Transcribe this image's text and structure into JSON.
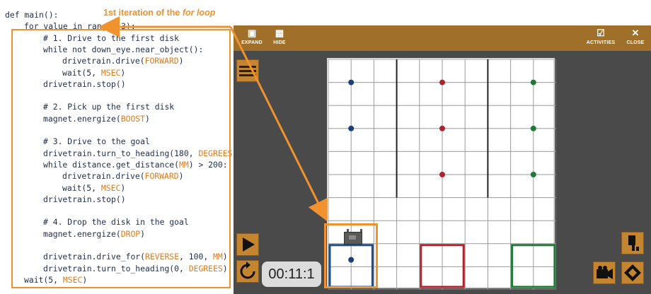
{
  "annotation": {
    "label_pre": "1st iteration of the ",
    "label_em": "for loop"
  },
  "code": [
    {
      "i": 0,
      "parts": [
        {
          "t": "def main():",
          "c": "kw"
        }
      ]
    },
    {
      "i": 1,
      "parts": [
        {
          "t": "for value in range (3):",
          "c": "kw"
        }
      ]
    },
    {
      "i": 2,
      "parts": [
        {
          "t": "# 1. Drive to the first disk",
          "c": "kw"
        }
      ]
    },
    {
      "i": 2,
      "parts": [
        {
          "t": "while not down_eye.near_object():",
          "c": "kw"
        }
      ]
    },
    {
      "i": 3,
      "parts": [
        {
          "t": "drivetrain.drive(",
          "c": "kw"
        },
        {
          "t": "FORWARD",
          "c": "cst"
        },
        {
          "t": ")",
          "c": "kw"
        }
      ]
    },
    {
      "i": 3,
      "parts": [
        {
          "t": "wait(5, ",
          "c": "kw"
        },
        {
          "t": "MSEC",
          "c": "cst"
        },
        {
          "t": ")",
          "c": "kw"
        }
      ]
    },
    {
      "i": 2,
      "parts": [
        {
          "t": "drivetrain.stop()",
          "c": "kw"
        }
      ]
    },
    {
      "i": 2,
      "parts": [
        {
          "t": "",
          "c": "kw"
        }
      ]
    },
    {
      "i": 2,
      "parts": [
        {
          "t": "# 2. Pick up the first disk",
          "c": "kw"
        }
      ]
    },
    {
      "i": 2,
      "parts": [
        {
          "t": "magnet.energize(",
          "c": "kw"
        },
        {
          "t": "BOOST",
          "c": "cst"
        },
        {
          "t": ")",
          "c": "kw"
        }
      ]
    },
    {
      "i": 2,
      "parts": [
        {
          "t": "",
          "c": "kw"
        }
      ]
    },
    {
      "i": 2,
      "parts": [
        {
          "t": "# 3. Drive to the goal",
          "c": "kw"
        }
      ]
    },
    {
      "i": 2,
      "parts": [
        {
          "t": "drivetrain.turn_to_heading(180, ",
          "c": "kw"
        },
        {
          "t": "DEGREES",
          "c": "cst"
        },
        {
          "t": ")",
          "c": "kw"
        }
      ]
    },
    {
      "i": 2,
      "parts": [
        {
          "t": "while distance.get_distance(",
          "c": "kw"
        },
        {
          "t": "MM",
          "c": "cst"
        },
        {
          "t": ") > 200:",
          "c": "kw"
        }
      ]
    },
    {
      "i": 3,
      "parts": [
        {
          "t": "drivetrain.drive(",
          "c": "kw"
        },
        {
          "t": "FORWARD",
          "c": "cst"
        },
        {
          "t": ")",
          "c": "kw"
        }
      ]
    },
    {
      "i": 3,
      "parts": [
        {
          "t": "wait(5, ",
          "c": "kw"
        },
        {
          "t": "MSEC",
          "c": "cst"
        },
        {
          "t": ")",
          "c": "kw"
        }
      ]
    },
    {
      "i": 2,
      "parts": [
        {
          "t": "drivetrain.stop()",
          "c": "kw"
        }
      ]
    },
    {
      "i": 2,
      "parts": [
        {
          "t": "",
          "c": "kw"
        }
      ]
    },
    {
      "i": 2,
      "parts": [
        {
          "t": "# 4. Drop the disk in the goal",
          "c": "kw"
        }
      ]
    },
    {
      "i": 2,
      "parts": [
        {
          "t": "magnet.energize(",
          "c": "kw"
        },
        {
          "t": "DROP",
          "c": "cst"
        },
        {
          "t": ")",
          "c": "kw"
        }
      ]
    },
    {
      "i": 2,
      "parts": [
        {
          "t": "",
          "c": "kw"
        }
      ]
    },
    {
      "i": 2,
      "parts": [
        {
          "t": "drivetrain.drive_for(",
          "c": "kw"
        },
        {
          "t": "REVERSE",
          "c": "cst"
        },
        {
          "t": ", 100, ",
          "c": "kw"
        },
        {
          "t": "MM",
          "c": "cst"
        },
        {
          "t": ")",
          "c": "kw"
        }
      ]
    },
    {
      "i": 2,
      "parts": [
        {
          "t": "drivetrain.turn_to_heading(0, ",
          "c": "kw"
        },
        {
          "t": "DEGREES",
          "c": "cst"
        },
        {
          "t": ")",
          "c": "kw"
        }
      ]
    },
    {
      "i": 1,
      "parts": [
        {
          "t": "wait(5, ",
          "c": "kw"
        },
        {
          "t": "MSEC",
          "c": "cst"
        },
        {
          "t": ")",
          "c": "kw"
        }
      ]
    }
  ],
  "toolbar": {
    "expand": "EXPAND",
    "hide": "HIDE",
    "activities": "ACTIVITIES",
    "close": "CLOSE"
  },
  "timer": "00:11:1",
  "field": {
    "disks": [
      {
        "col": 0,
        "row": 0,
        "color": "#1f3f7a"
      },
      {
        "col": 0,
        "row": 1,
        "color": "#1f3f7a"
      },
      {
        "col": 1,
        "row": 0,
        "color": "#b0232e"
      },
      {
        "col": 1,
        "row": 1,
        "color": "#b0232e"
      },
      {
        "col": 1,
        "row": 2,
        "color": "#b0232e"
      },
      {
        "col": 2,
        "row": 0,
        "color": "#1e7a36"
      },
      {
        "col": 2,
        "row": 1,
        "color": "#1e7a36"
      },
      {
        "col": 2,
        "row": 2,
        "color": "#1e7a36"
      },
      {
        "col": 0,
        "row": 4,
        "color": "#1f3f7a"
      }
    ],
    "goal_colors": [
      "#1f4f8a",
      "#b0232e",
      "#1e7a36"
    ]
  },
  "colors": {
    "accent": "#f0922d",
    "toolbar": "#a0702a",
    "button": "#c3852f"
  }
}
